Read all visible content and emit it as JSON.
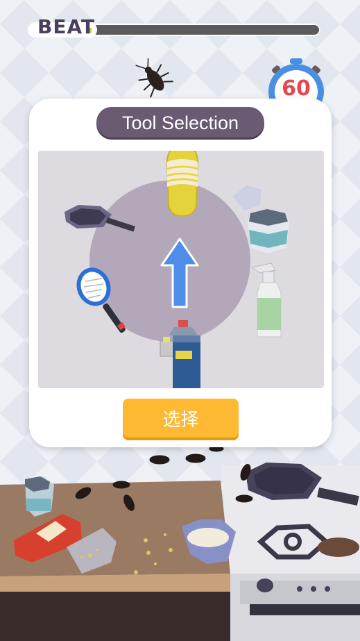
{
  "hud": {
    "beat_label": "BEAT",
    "timer_value": "60"
  },
  "panel": {
    "title": "Tool Selection",
    "select_button": "选择"
  },
  "tools": [
    {
      "name": "slipper",
      "icon": "slipper-icon"
    },
    {
      "name": "bug spray can",
      "icon": "spray-can-icon"
    },
    {
      "name": "spray bottle",
      "icon": "spray-bottle-icon"
    },
    {
      "name": "powder jar",
      "icon": "jar-icon"
    },
    {
      "name": "frying pan",
      "icon": "frying-pan-icon"
    },
    {
      "name": "electric swatter",
      "icon": "electric-swatter-icon"
    }
  ],
  "colors": {
    "title_pill": "#6a5a72",
    "select_button": "#ffb933",
    "timer_ring": "#4a8fe4",
    "timer_text": "#e4484f",
    "arrow": "#4e8de8"
  }
}
